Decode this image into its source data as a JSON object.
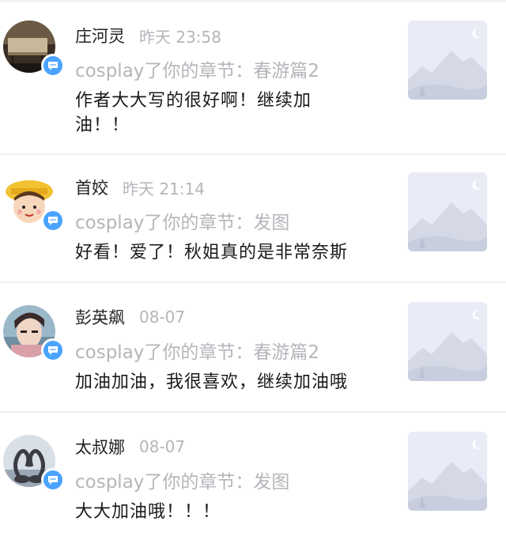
{
  "comments": [
    {
      "name": "庄河灵",
      "time": "昨天 23:58",
      "action": "cosplay了你的章节：春游篇2",
      "text": "作者大大写的很好啊！继续加油！！",
      "avatar": "avatar-bench-photo"
    },
    {
      "name": "首姣",
      "time": "昨天 21:14",
      "action": "cosplay了你的章节：发图",
      "text": "好看！爱了！秋姐真的是非常奈斯",
      "avatar": "avatar-cartoon-girl"
    },
    {
      "name": "彭英飙",
      "time": "08-07",
      "action": "cosplay了你的章节：春游篇2",
      "text": "加油加油，我很喜欢，继续加油哦",
      "avatar": "avatar-person-photo"
    },
    {
      "name": "太叔娜",
      "time": "08-07",
      "action": "cosplay了你的章节：发图",
      "text": "大大加油哦！！！",
      "avatar": "avatar-swans-photo"
    }
  ],
  "icons": {
    "badge": "comment-bubble-icon",
    "thumbnail": "image-placeholder-icon"
  },
  "colors": {
    "badge_blue": "#4aa3ff",
    "meta_gray": "#b5b5bb",
    "placeholder_bg": "#e9ecf6"
  }
}
